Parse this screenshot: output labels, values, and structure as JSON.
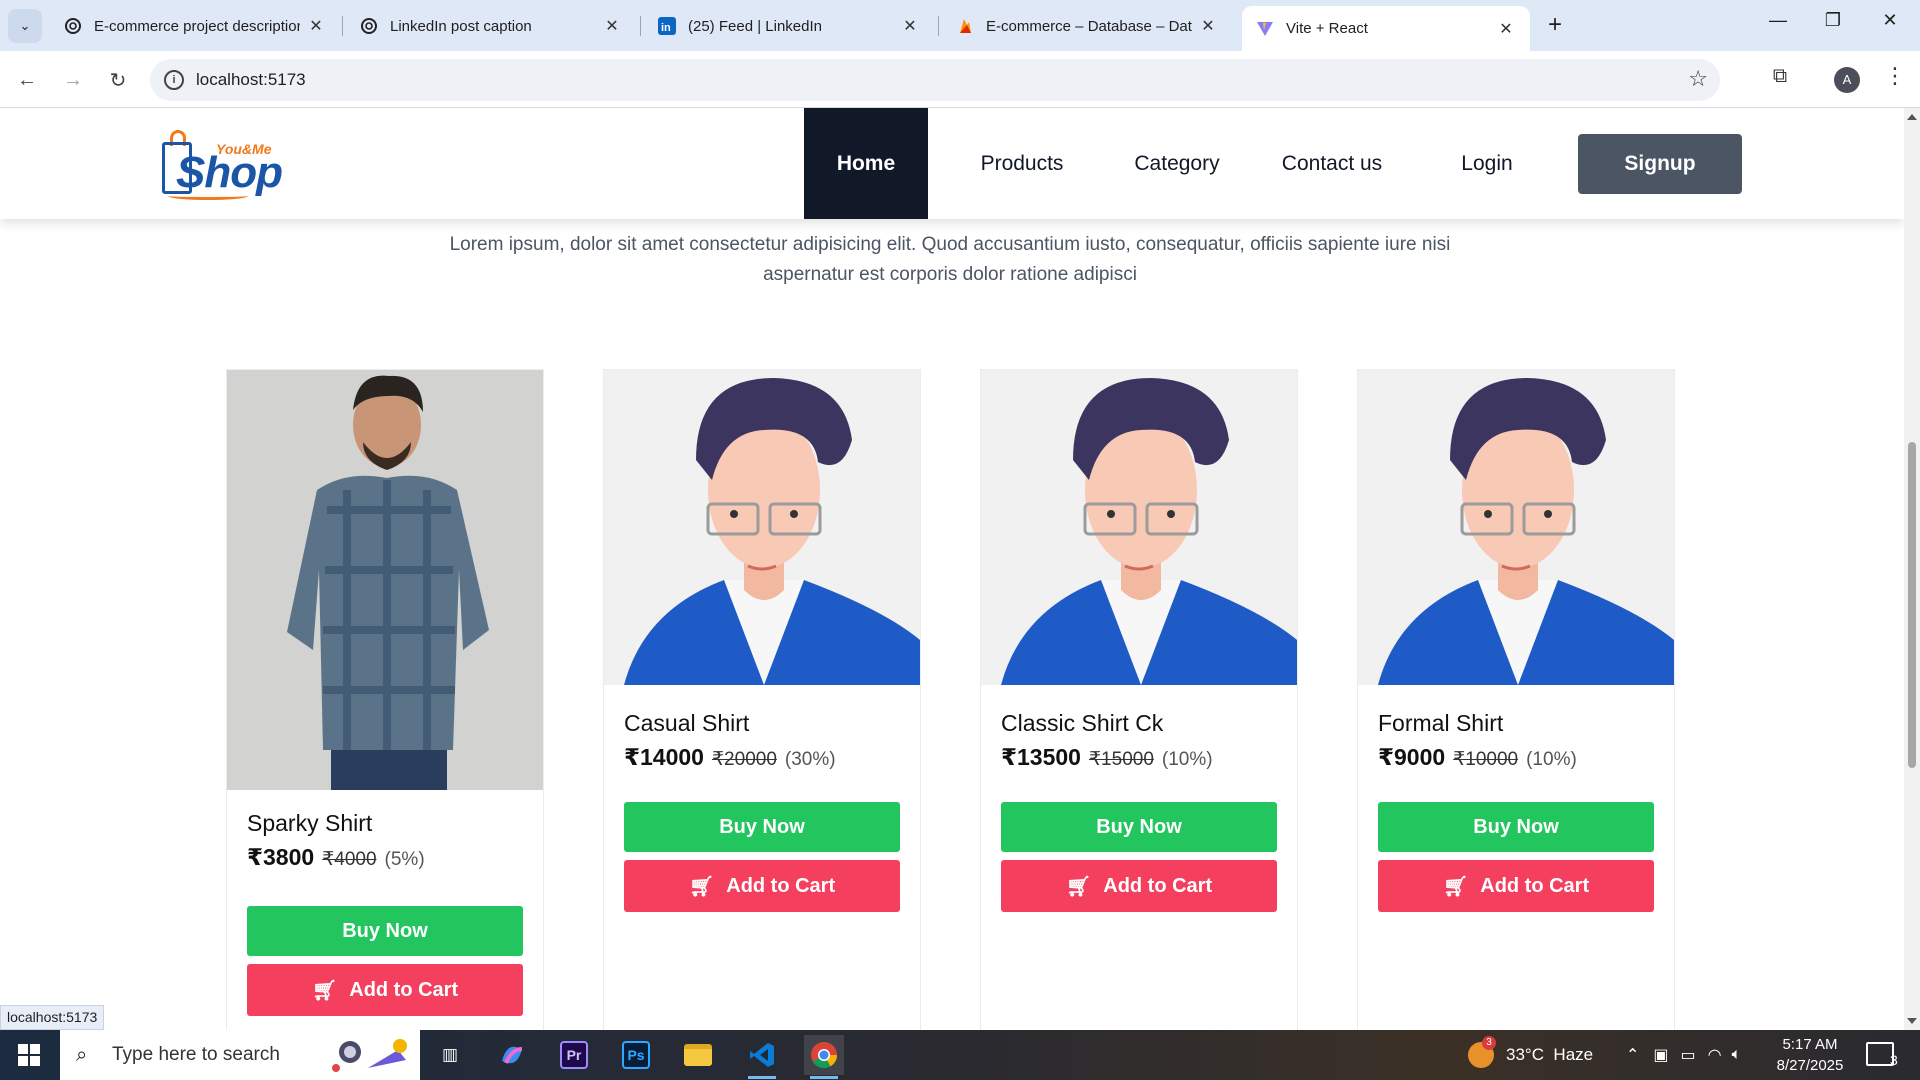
{
  "browser": {
    "tabs": [
      {
        "title": "E-commerce project description",
        "icon": "chatgpt-icon",
        "active": false
      },
      {
        "title": "LinkedIn post caption",
        "icon": "chatgpt-icon",
        "active": false
      },
      {
        "title": "(25) Feed | LinkedIn",
        "icon": "linkedin-icon",
        "active": false
      },
      {
        "title": "E-commerce – Database – Data",
        "icon": "firebase-icon",
        "active": false
      },
      {
        "title": "Vite + React",
        "icon": "vite-icon",
        "active": true
      }
    ],
    "url": "localhost:5173",
    "profile_initial": "A"
  },
  "site": {
    "logo": {
      "small": "You&Me",
      "big": "Shop"
    },
    "nav": [
      "Home",
      "Products",
      "Category",
      "Contact us",
      "Login"
    ],
    "active_nav": "Home",
    "signup": "Signup",
    "intro": "Lorem ipsum, dolor sit amet consectetur adipisicing elit. Quod accusantium iusto, consequatur, officiis sapiente iure nisi aspernatur est corporis dolor ratione adipisci"
  },
  "products": [
    {
      "name": "Sparky Shirt",
      "price": "₹3800",
      "mrp": "₹4000",
      "discount": "(5%)",
      "buy": "Buy Now",
      "cart": "Add to Cart",
      "image": "model-photo"
    },
    {
      "name": "Casual Shirt",
      "price": "₹14000",
      "mrp": "₹20000",
      "discount": "(30%)",
      "buy": "Buy Now",
      "cart": "Add to Cart",
      "image": "avatar-illustration"
    },
    {
      "name": "Classic Shirt Ck",
      "price": "₹13500",
      "mrp": "₹15000",
      "discount": "(10%)",
      "buy": "Buy Now",
      "cart": "Add to Cart",
      "image": "avatar-illustration"
    },
    {
      "name": "Formal Shirt",
      "price": "₹9000",
      "mrp": "₹10000",
      "discount": "(10%)",
      "buy": "Buy Now",
      "cart": "Add to Cart",
      "image": "avatar-illustration"
    }
  ],
  "status_bar": "localhost:5173",
  "taskbar": {
    "search_placeholder": "Type here to search",
    "weather": "33°C  Haze",
    "weather_badge": "3",
    "time": "5:17 AM",
    "date": "8/27/2025",
    "notifications": "3",
    "apps": [
      "task-view-icon",
      "copilot-icon",
      "premiere-icon",
      "photoshop-icon",
      "file-explorer-icon",
      "vscode-icon",
      "chrome-icon"
    ]
  },
  "colors": {
    "nav_active_bg": "#111827",
    "signup_bg": "#4b5563",
    "buy_now": "#22c55e",
    "add_to_cart": "#f43f5e",
    "logo_blue": "#1a55a8",
    "logo_orange": "#f07a1c"
  }
}
